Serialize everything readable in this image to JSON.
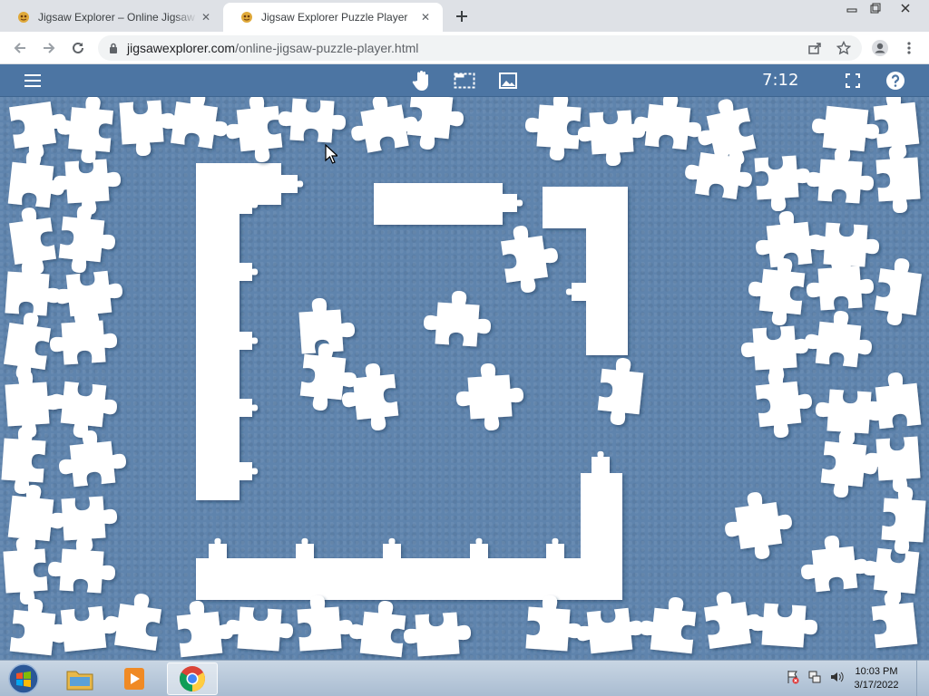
{
  "browser": {
    "tabs": [
      {
        "title": "Jigsaw Explorer – Online Jigsaw Puzzles",
        "active": false
      },
      {
        "title": "Jigsaw Explorer Puzzle Player",
        "active": true
      }
    ],
    "url_domain": "jigsawexplorer.com",
    "url_path": "/online-jigsaw-puzzle-player.html"
  },
  "player": {
    "timer": "7:12",
    "buttons": [
      "menu-icon",
      "hand-icon",
      "select-area-icon",
      "image-preview-icon",
      "fullscreen-icon",
      "help-icon"
    ]
  },
  "board": {
    "background_color": "#5f84ad",
    "piece_color": "#ffffff"
  },
  "taskbar": {
    "apps": [
      "start-orb",
      "file-explorer",
      "media-player",
      "chrome"
    ],
    "clock_time": "10:03 PM",
    "clock_date": "3/17/2022"
  }
}
